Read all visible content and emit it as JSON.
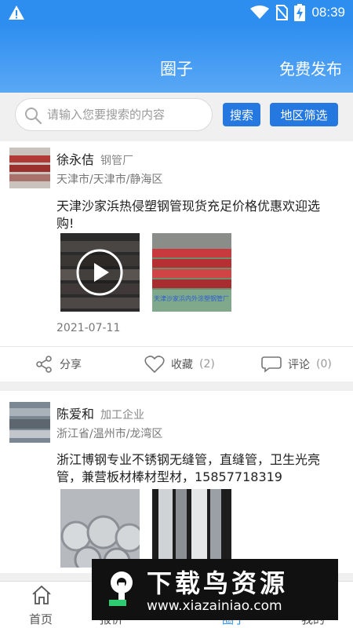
{
  "status": {
    "time": "08:39"
  },
  "header": {
    "title": "圈子",
    "publish_label": "免费发布"
  },
  "search": {
    "placeholder": "请输入您要搜索的内容",
    "search_label": "搜索",
    "region_label": "地区筛选"
  },
  "posts": [
    {
      "author": "徐永佶",
      "tag": "钢管厂",
      "location": "天津市/天津市/静海区",
      "content": "天津沙家浜热侵塑钢管现货充足价格优惠欢迎选购!",
      "image2_caption": "天津沙家浜内外涂塑钢管厂",
      "date": "2021-07-11",
      "share_label": "分享",
      "favorite_label": "收藏",
      "favorite_count": "(2)",
      "comment_label": "评论",
      "comment_count": "(0)"
    },
    {
      "author": "陈爱和",
      "tag": "加工企业",
      "location": "浙江省/温州市/龙湾区",
      "content": "浙江博钢专业不锈钢无缝管，直缝管，卫生光亮管，兼营板材棒材型材，15857718319"
    }
  ],
  "nav": [
    {
      "label": "首页"
    },
    {
      "label": "报价"
    },
    {
      "label": "圈子"
    },
    {
      "label": "我的"
    }
  ],
  "watermark": {
    "title": "下载鸟资源",
    "url": "www.xiazainiao.com"
  },
  "colors": {
    "primary": "#2e8ef0",
    "button": "#2478e0"
  }
}
